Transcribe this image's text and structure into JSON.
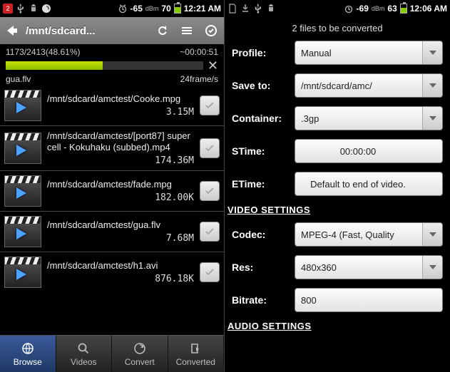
{
  "left": {
    "status": {
      "badge": "2",
      "signal_text": "-65",
      "dbm": "dBm",
      "batt_text": "70",
      "batt_fill_pct": 68,
      "time": "12:21 AM"
    },
    "titlebar": {
      "path": "/mnt/sdcard..."
    },
    "progress": {
      "count_pct": "1173/2413(48.61%)",
      "eta": "~00:00:51",
      "fill_pct": 49,
      "file": "gua.flv",
      "rate": "24frame/s"
    },
    "files": [
      {
        "path": "/mnt/sdcard/amctest/Cooke.mpg",
        "size": "3.15M"
      },
      {
        "path": "/mnt/sdcard/amctest/[port87] supercell - Kokuhaku (subbed).mp4",
        "size": "174.36M"
      },
      {
        "path": "/mnt/sdcard/amctest/fade.mpg",
        "size": "182.00K"
      },
      {
        "path": "/mnt/sdcard/amctest/gua.flv",
        "size": "7.68M"
      },
      {
        "path": "/mnt/sdcard/amctest/h1.avi",
        "size": "876.18K"
      }
    ],
    "tabs": [
      {
        "label": "Browse",
        "icon": "globe-icon"
      },
      {
        "label": "Videos",
        "icon": "search-icon"
      },
      {
        "label": "Convert",
        "icon": "convert-icon"
      },
      {
        "label": "Converted",
        "icon": "export-icon"
      }
    ],
    "active_tab": 0
  },
  "right": {
    "status": {
      "signal_text": "-69",
      "dbm": "dBm",
      "batt_text": "63",
      "batt_fill_pct": 60,
      "time": "12:06 AM"
    },
    "header": "2  files to be converted",
    "sections": {
      "video_hdr": "VIDEO SETTINGS",
      "audio_hdr": "AUDIO SETTINGS"
    },
    "fields": {
      "profile": {
        "label": "Profile:",
        "value": "Manual",
        "dropdown": true
      },
      "saveto": {
        "label": "Save to:",
        "value": "/mnt/sdcard/amc/",
        "dropdown": true
      },
      "container": {
        "label": "Container:",
        "value": ".3gp",
        "dropdown": true
      },
      "stime": {
        "label": "STime:",
        "value": "00:00:00",
        "dropdown": false,
        "centered": true
      },
      "etime": {
        "label": "ETime:",
        "value": "Default to end of video.",
        "dropdown": false,
        "centered": true
      },
      "codec": {
        "label": "Codec:",
        "value": "MPEG-4 (Fast, Quality",
        "dropdown": true
      },
      "res": {
        "label": "Res:",
        "value": "480x360",
        "dropdown": true
      },
      "bitrate": {
        "label": "Bitrate:",
        "value": "800",
        "dropdown": false
      }
    }
  }
}
